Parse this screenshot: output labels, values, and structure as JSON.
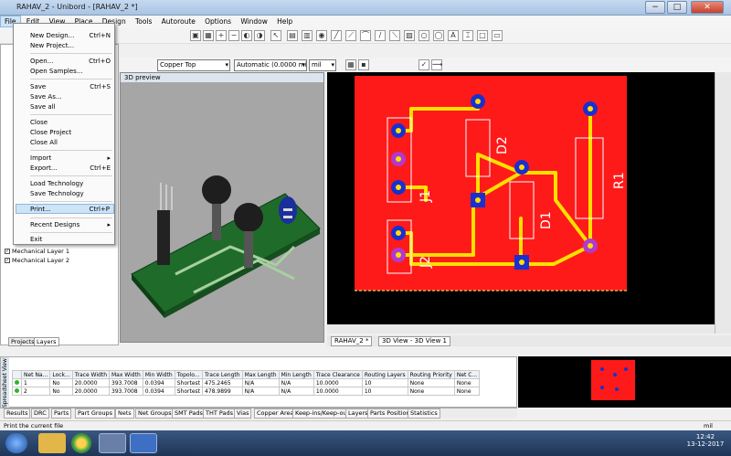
{
  "window": {
    "title": "RAHAV_2 - Unibord - [RAHAV_2 *]",
    "minimize": "−",
    "maximize": "□",
    "close": "✕"
  },
  "menubar": [
    "File",
    "Edit",
    "View",
    "Place",
    "Design",
    "Tools",
    "Autoroute",
    "Options",
    "Window",
    "Help"
  ],
  "file_menu": [
    {
      "label": "New Design...",
      "shortcut": "Ctrl+N"
    },
    {
      "label": "New Project...",
      "shortcut": ""
    },
    {
      "label": "Open...",
      "shortcut": "Ctrl+O"
    },
    {
      "label": "Open Samples...",
      "shortcut": ""
    },
    {
      "label": "Save",
      "shortcut": "Ctrl+S"
    },
    {
      "label": "Save As...",
      "shortcut": ""
    },
    {
      "label": "Save all",
      "shortcut": ""
    },
    {
      "label": "Close",
      "shortcut": ""
    },
    {
      "label": "Close Project",
      "shortcut": ""
    },
    {
      "label": "Close All",
      "shortcut": ""
    },
    {
      "label": "Import",
      "shortcut": "▸"
    },
    {
      "label": "Export...",
      "shortcut": "Ctrl+E"
    },
    {
      "label": "Load Technology",
      "shortcut": ""
    },
    {
      "label": "Save Technology",
      "shortcut": ""
    },
    {
      "label": "Print...",
      "shortcut": "Ctrl+P"
    },
    {
      "label": "Recent Designs",
      "shortcut": "▸"
    },
    {
      "label": "Exit",
      "shortcut": ""
    }
  ],
  "toolbar2": {
    "layer_select": "Copper Top",
    "width_select": "Automatic (0.0000 mil",
    "units_select": "mil"
  },
  "left_panel": {
    "layers": [
      "Mechanical Layer 1",
      "Mechanical Layer 2"
    ],
    "tabs": [
      "Projects",
      "Layers"
    ]
  },
  "preview": {
    "title": "3D preview"
  },
  "doc_tabs": [
    "RAHAV_2 *",
    "3D View - 3D View 1"
  ],
  "pcb": {
    "labels": [
      "D2",
      "J1",
      "D1",
      "R1",
      "J2"
    ]
  },
  "spreadsheet": {
    "side_label": "Spreadsheet View",
    "columns": [
      "",
      "Net Na...",
      "Lock...",
      "Trace Width",
      "Max Width",
      "Min Width",
      "Topolo...",
      "Trace Length",
      "Max Length",
      "Min Length",
      "Trace Clearance",
      "Routing Layers",
      "Routing Priority",
      "Net C..."
    ],
    "rows": [
      [
        "",
        "1",
        "No",
        "20.0000",
        "393.7008",
        "0.0394",
        "Shortest",
        "475.2465",
        "N/A",
        "N/A",
        "10.0000",
        "10",
        "None",
        "None"
      ],
      [
        "",
        "2",
        "No",
        "20.0000",
        "393.7008",
        "0.0394",
        "Shortest",
        "478.9899",
        "N/A",
        "N/A",
        "10.0000",
        "10",
        "None",
        "None"
      ]
    ]
  },
  "bottom_tabs": [
    "Results",
    "DRC",
    "Parts",
    "Part Groups",
    "Nets",
    "Net Groups",
    "SMT Pads",
    "THT Pads",
    "Vias",
    "Copper Areas",
    "Keep-ins/Keep-outs",
    "Layers",
    "Parts Position",
    "Statistics"
  ],
  "status": {
    "message": "Print the current file",
    "units": "mil"
  },
  "taskbar": {
    "time": "12:42",
    "date": "13-12-2017"
  },
  "colors": {
    "board": "#ff1a1a",
    "trace": "#ffe000",
    "pad": "#1a2fd0"
  }
}
